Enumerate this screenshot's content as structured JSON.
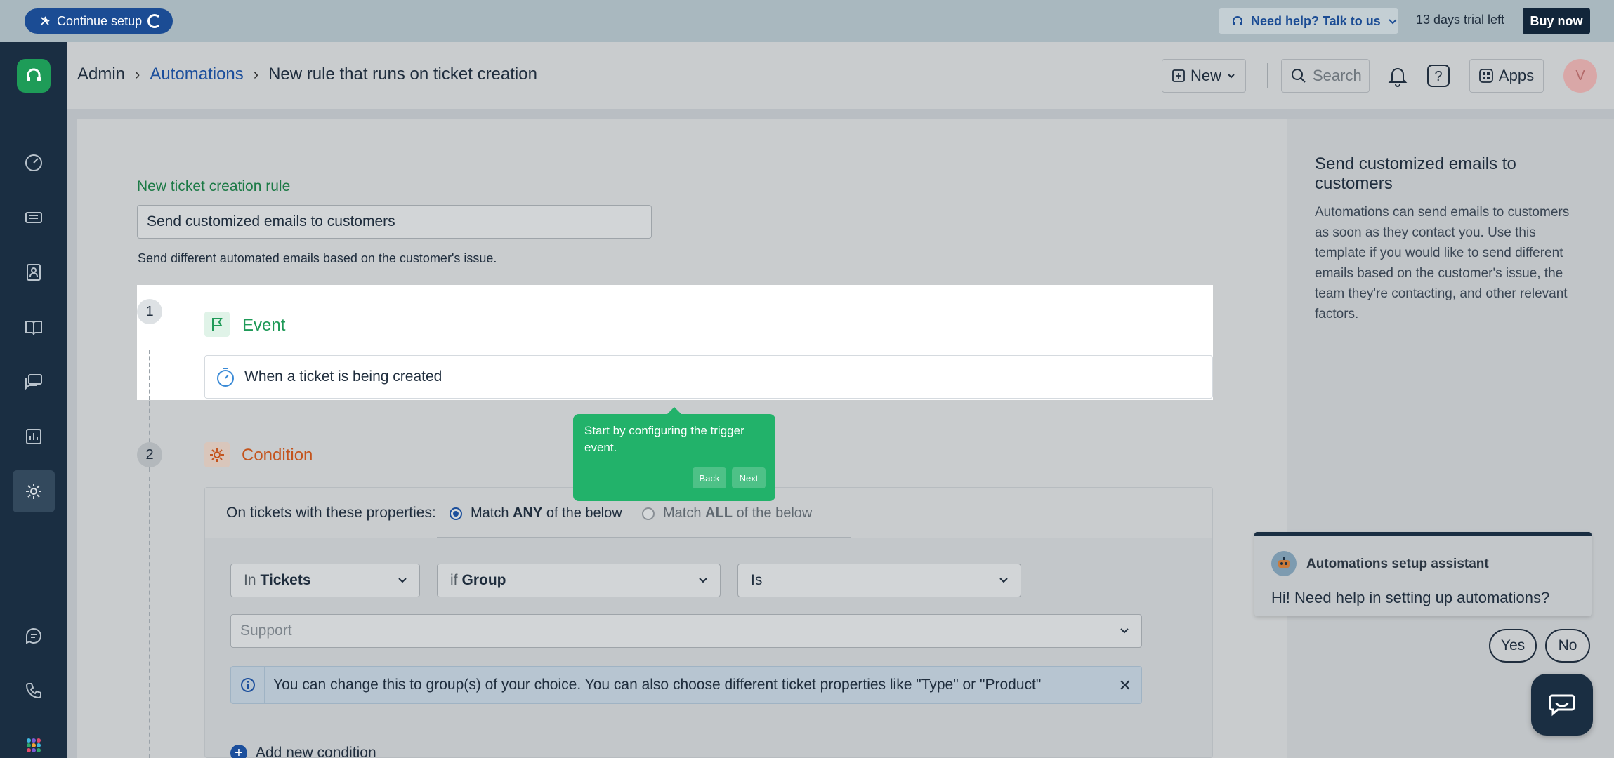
{
  "topbar": {
    "continue_setup": "Continue setup",
    "help": "Need help? Talk to us",
    "trial": "13 days trial left",
    "buy": "Buy now"
  },
  "header": {
    "breadcrumb": [
      "Admin",
      "Automations",
      "New rule that runs on ticket creation"
    ],
    "new_label": "New",
    "search_placeholder": "Search",
    "apps_label": "Apps",
    "avatar_initial": "V"
  },
  "rule": {
    "label": "New ticket creation rule",
    "name": "Send customized emails to customers",
    "description": "Send different automated emails based on the customer's issue."
  },
  "event": {
    "step": "1",
    "title": "Event",
    "trigger": "When a ticket is being created"
  },
  "tooltip": {
    "text": "Start by configuring the trigger event.",
    "back": "Back",
    "next": "Next"
  },
  "condition": {
    "step": "2",
    "title": "Condition",
    "header_label": "On tickets with these properties:",
    "match_any_pre": "Match ",
    "match_any_bold": "ANY",
    "match_any_post": " of the below",
    "match_all_pre": "Match ",
    "match_all_bold": "ALL",
    "match_all_post": " of the below",
    "in_pre": "In",
    "in_value": "Tickets",
    "if_pre": "if",
    "if_value": "Group",
    "operator": "Is",
    "value_placeholder": "Support",
    "info": "You can change this to group(s) of your choice. You can also choose different ticket properties like \"Type\" or \"Product\"",
    "add_new": "Add new condition"
  },
  "right_panel": {
    "title": "Send customized emails to customers",
    "text": "Automations can send emails to customers as soon as they contact you. Use this template if you would like to send different emails based on the customer's issue, the team they're contacting, and other relevant factors."
  },
  "assistant": {
    "name": "Automations setup assistant",
    "message": "Hi! Need help in setting up automations?",
    "yes": "Yes",
    "no": "No"
  },
  "sidebar": {
    "items": [
      "dashboard-icon",
      "tickets-icon",
      "contacts-icon",
      "knowledge-base-icon",
      "conversations-icon",
      "reports-icon",
      "admin-gear-icon",
      "chat-icon",
      "phone-icon",
      "apps-grid-icon"
    ]
  }
}
